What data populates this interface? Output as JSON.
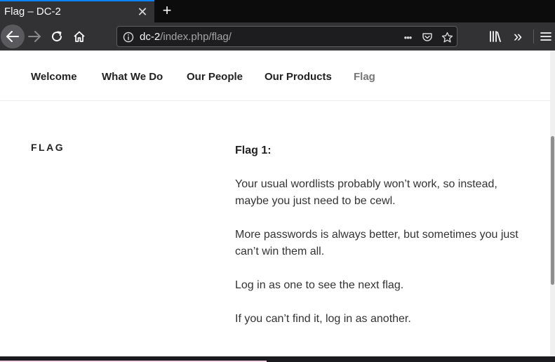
{
  "colors": {
    "tab_accent": "#0a84ff",
    "chrome_dark": "#0c0c0d",
    "chrome": "#323234",
    "urlbar_bg": "#1d1d20",
    "text_dark": "#222222",
    "nav_current": "#767676"
  },
  "browser": {
    "tab": {
      "title": "Flag – DC-2",
      "close_glyph": "✕",
      "close_icon": "close-icon"
    },
    "new_tab_glyph": "+",
    "url": {
      "host": "dc-2",
      "path": "/index.php/flag/"
    },
    "icons": [
      "back-arrow-icon",
      "forward-arrow-icon",
      "reload-icon",
      "home-icon",
      "info-icon",
      "page-actions-icon",
      "pocket-icon",
      "bookmark-star-icon",
      "library-icon",
      "overflow-chevron-icon",
      "hamburger-menu-icon"
    ],
    "page_actions_glyph": "•••",
    "overflow_glyph": "»"
  },
  "site": {
    "menu": [
      {
        "label": "Welcome"
      },
      {
        "label": "What We Do"
      },
      {
        "label": "Our People"
      },
      {
        "label": "Our Products"
      },
      {
        "label": "Flag",
        "current": true
      }
    ],
    "page_title": "FLAG",
    "entry": {
      "heading": "Flag 1:",
      "paragraphs": [
        "Your usual wordlists probably won’t work, so instead, maybe you just need to be cewl.",
        "More passwords is always better, but sometimes you just can’t win them all.",
        "Log in as one to see the next flag.",
        "If you can’t find it, log in as another."
      ]
    }
  }
}
